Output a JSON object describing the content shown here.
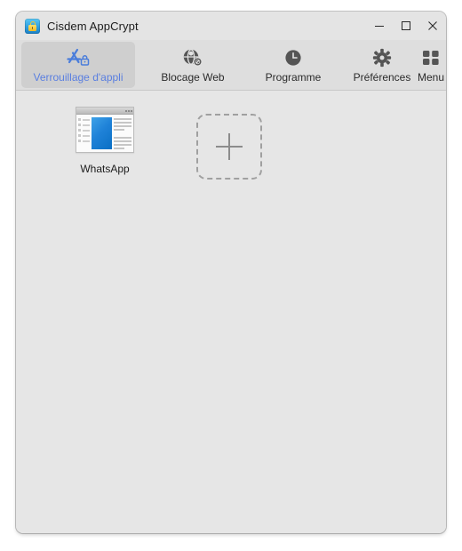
{
  "window": {
    "title": "Cisdem AppCrypt",
    "icon": "padlock-icon",
    "controls": {
      "minimize_label": "Minimize",
      "maximize_label": "Maximize",
      "close_label": "Close"
    }
  },
  "toolbar": {
    "tabs": [
      {
        "id": "app-lock",
        "label": "Verrouillage d'appli",
        "icon": "app-lock-icon",
        "selected": true
      },
      {
        "id": "web-block",
        "label": "Blocage Web",
        "icon": "globe-block-icon",
        "selected": false
      },
      {
        "id": "schedule",
        "label": "Programme",
        "icon": "clock-icon",
        "selected": false
      },
      {
        "id": "prefs",
        "label": "Préférences",
        "icon": "gear-icon",
        "selected": false
      },
      {
        "id": "menu",
        "label": "Menu",
        "icon": "grid-dots-icon",
        "selected": false
      }
    ]
  },
  "main": {
    "apps": [
      {
        "name": "WhatsApp",
        "icon": "generic-app-window-icon"
      }
    ],
    "add_tile": {
      "icon": "plus-icon",
      "label": ""
    }
  },
  "colors": {
    "accent": "#5a7fe0",
    "titlebar_bg": "#e4e4e4",
    "toolbar_bg": "#dedede",
    "tab_selected_bg": "#cfcfcf",
    "content_bg": "#e6e6e6",
    "app_icon_blue": "#1f82d8",
    "lock_gold": "#f5c62c",
    "dashed_border": "#a0a0a0"
  }
}
